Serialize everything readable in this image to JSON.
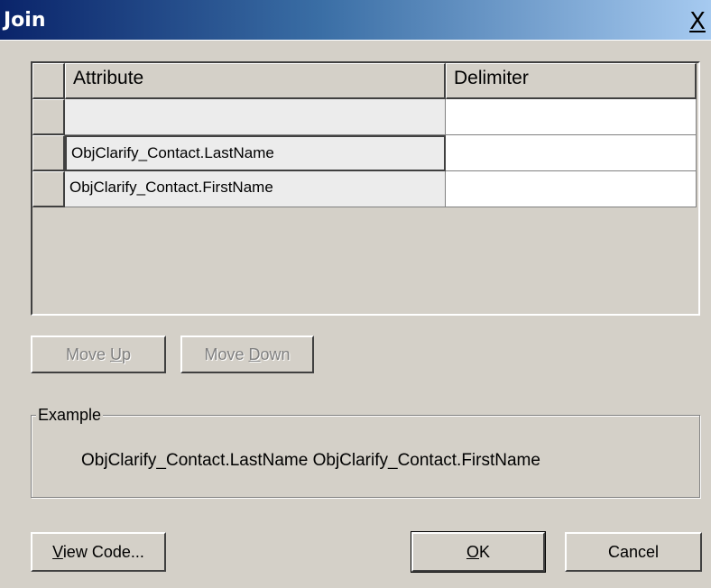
{
  "window": {
    "title": "Join",
    "close_glyph": "X"
  },
  "grid": {
    "columns": [
      "Attribute",
      "Delimiter"
    ],
    "rows": [
      {
        "attribute": "",
        "delimiter": ""
      },
      {
        "attribute": "ObjClarify_Contact.LastName",
        "delimiter": ""
      },
      {
        "attribute": "ObjClarify_Contact.FirstName",
        "delimiter": ""
      }
    ]
  },
  "buttons": {
    "move_up": {
      "pre": "Move ",
      "accel": "U",
      "post": "p"
    },
    "move_down": {
      "pre": "Move ",
      "accel": "D",
      "post": "own"
    },
    "view_code": {
      "pre": "",
      "accel": "V",
      "post": "iew Code..."
    },
    "ok": {
      "pre": "",
      "accel": "O",
      "post": "K"
    },
    "cancel": {
      "label": "Cancel"
    }
  },
  "example": {
    "title": "Example",
    "text": "ObjClarify_Contact.LastName ObjClarify_Contact.FirstName"
  },
  "icons": {
    "close": "close-icon"
  }
}
